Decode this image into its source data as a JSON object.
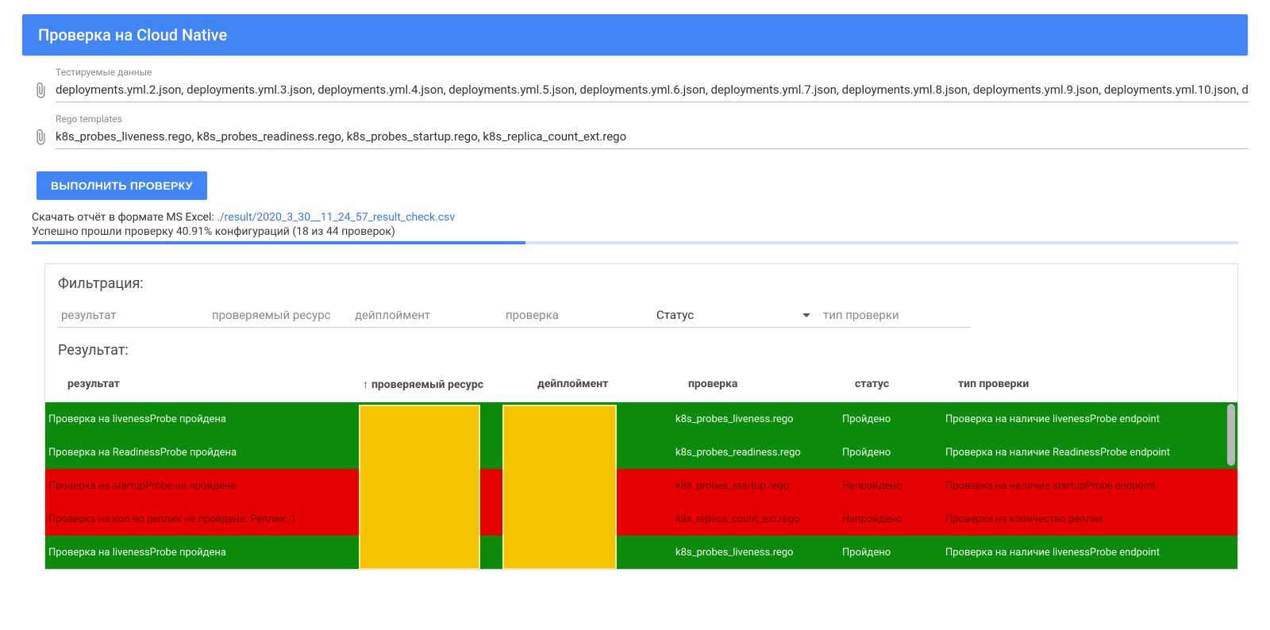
{
  "header": {
    "title": "Проверка на Cloud Native"
  },
  "uploads": {
    "data_label": "Тестируемые данные",
    "data_value": "deployments.yml.2.json, deployments.yml.3.json, deployments.yml.4.json, deployments.yml.5.json, deployments.yml.6.json, deployments.yml.7.json, deployments.yml.8.json, deployments.yml.9.json, deployments.yml.10.json, d",
    "rego_label": "Rego templates",
    "rego_value": "k8s_probes_liveness.rego, k8s_probes_readiness.rego, k8s_probes_startup.rego, k8s_replica_count_ext.rego"
  },
  "actions": {
    "run_label": "ВЫПОЛНИТЬ ПРОВЕРКУ"
  },
  "download": {
    "prefix": "Скачать отчёт в формате MS Excel:  ",
    "link": "./result/2020_3_30__11_24_57_result_check.csv"
  },
  "summary": {
    "text": "Успешно прошли проверку 40.91% конфигураций (18 из 44 проверок)",
    "percent": 40.91,
    "passed": 18,
    "total": 44
  },
  "filters": {
    "title": "Фильтрация:",
    "result": "результат",
    "resource": "проверяемый ресурс",
    "deployment": "дейплоймент",
    "check": "проверка",
    "status": "Статус",
    "type": "тип проверки"
  },
  "results": {
    "title": "Результат:",
    "columns": {
      "result": "результат",
      "resource": "проверяемый ресурс",
      "sort_arrow": "↑",
      "deployment": "дейплоймент",
      "check": "проверка",
      "status": "статус",
      "type": "тип проверки"
    },
    "rows": [
      {
        "status_kind": "pass",
        "result": "Проверка на livenessProbe пройдена",
        "resource": "",
        "deployment": "",
        "check": "k8s_probes_liveness.rego",
        "status": "Пройдено",
        "type": "Проверка на наличие livenessProbe endpoint"
      },
      {
        "status_kind": "pass",
        "result": "Проверка на ReadinessProbe пройдена",
        "resource": "",
        "deployment": "",
        "check": "k8s_probes_readiness.rego",
        "status": "Пройдено",
        "type": "Проверка на наличие ReadinessProbe endpoint"
      },
      {
        "status_kind": "fail",
        "result": "Проверка на startupProbe не пройдена",
        "resource": "",
        "deployment": "",
        "check": "k8s_probes_startup.rego",
        "status": "Непройдено",
        "type": "Проверка на наличие startupProbe endpoint"
      },
      {
        "status_kind": "fail",
        "result": "Проверка на кол-во реплик не пройдена. Реплик: 1",
        "resource": "",
        "deployment": "",
        "check": "k8s_replica_count_ext.rego",
        "status": "Непройдено",
        "type": "Проверка на количество реплик"
      },
      {
        "status_kind": "pass",
        "result": "Проверка на livenessProbe пройдена",
        "resource": "",
        "deployment": "",
        "check": "k8s_probes_liveness.rego",
        "status": "Пройдено",
        "type": "Проверка на наличие livenessProbe endpoint"
      }
    ]
  }
}
